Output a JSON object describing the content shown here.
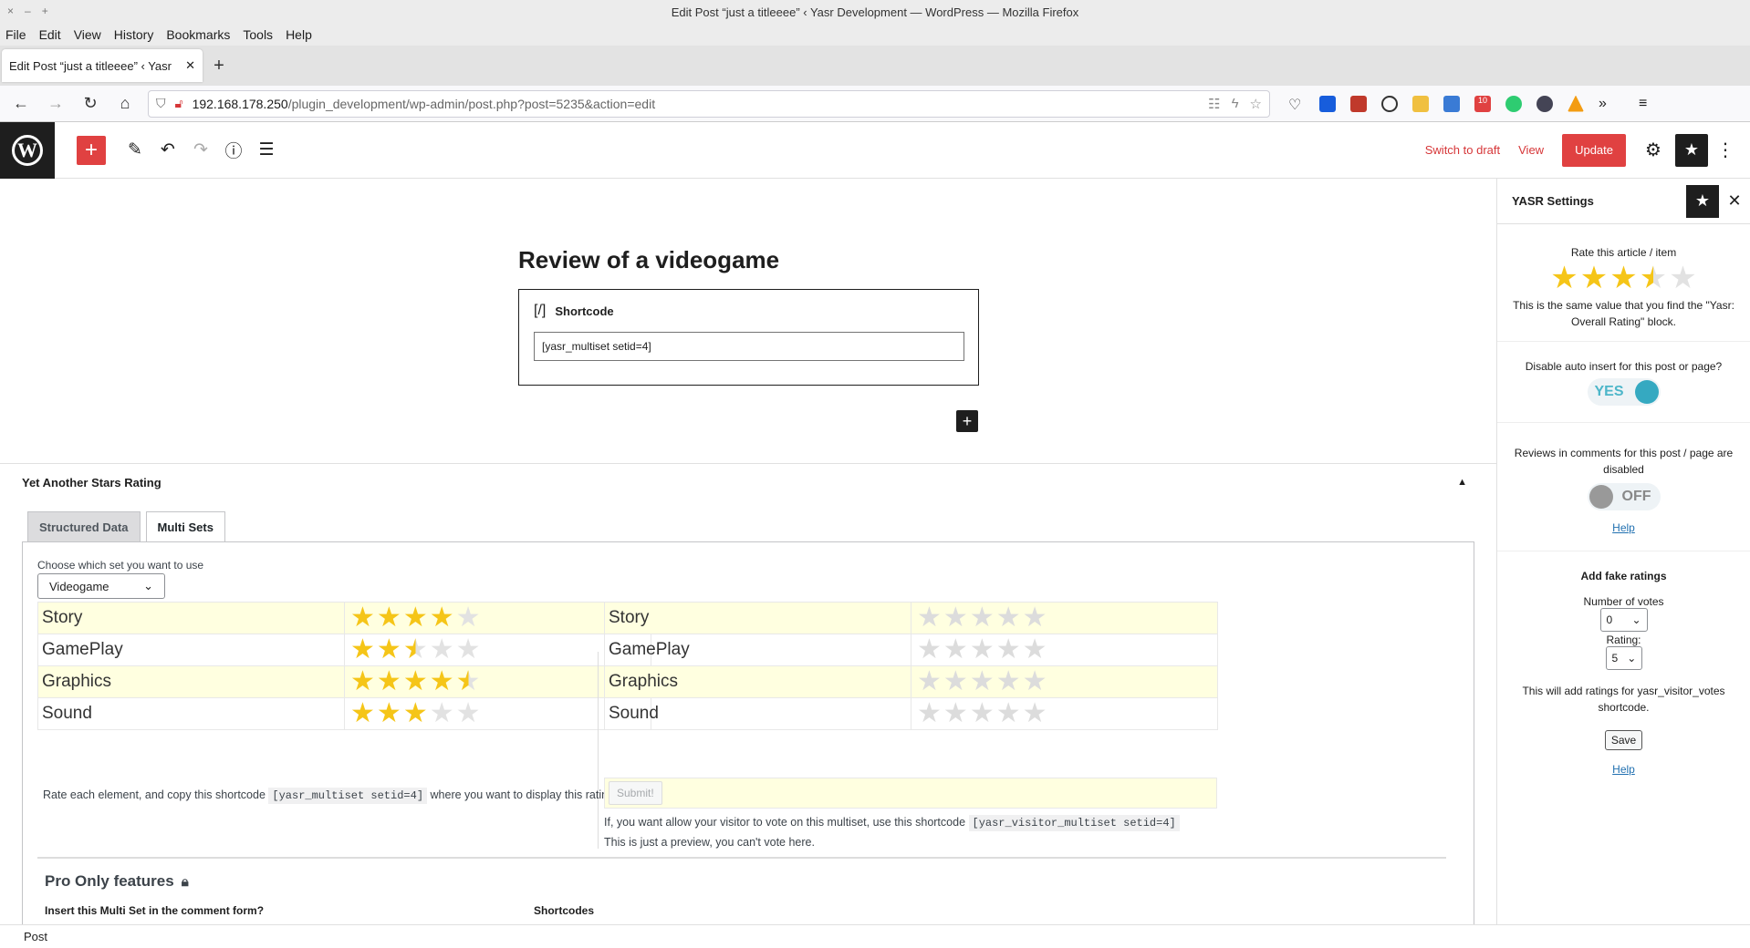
{
  "browser": {
    "window_title": "Edit Post “just a titleeee” ‹ Yasr Development — WordPress — Mozilla Firefox",
    "window_controls": [
      "×",
      "–",
      "+"
    ],
    "menu": [
      "File",
      "Edit",
      "View",
      "History",
      "Bookmarks",
      "Tools",
      "Help"
    ],
    "tab_title": "Edit Post “just a titleeee” ‹ Yasr",
    "url_host": "192.168.178.250",
    "url_path": "/plugin_development/wp-admin/post.php?post=5235&action=edit",
    "ext_badge": "10"
  },
  "toolbar": {
    "switch_to_draft": "Switch to draft",
    "view": "View",
    "update": "Update"
  },
  "editor": {
    "post_title": "Review of a videogame",
    "shortcode_icon": "[/]",
    "shortcode_label": "Shortcode",
    "shortcode_value": "[yasr_multiset setid=4]"
  },
  "metabox": {
    "title": "Yet Another Stars Rating",
    "tabs": [
      "Structured Data",
      "Multi Sets"
    ],
    "choose_label": "Choose which set you want to use",
    "selected_set": "Videogame",
    "left_rows": [
      {
        "name": "Story",
        "rating": 4
      },
      {
        "name": "GamePlay",
        "rating": 2.5
      },
      {
        "name": "Graphics",
        "rating": 4.5
      },
      {
        "name": "Sound",
        "rating": 3
      }
    ],
    "right_rows": [
      {
        "name": "Story",
        "rating": 0
      },
      {
        "name": "GamePlay",
        "rating": 0
      },
      {
        "name": "Graphics",
        "rating": 0
      },
      {
        "name": "Sound",
        "rating": 0
      }
    ],
    "left_note_pre": "Rate each element, and copy this shortcode",
    "left_note_code": "[yasr_multiset setid=4]",
    "left_note_post": "where you want to display this rating.",
    "submit_label": "Submit!",
    "right_note_pre": "If, you want allow your visitor to vote on this multiset, use this shortcode",
    "right_note_code": "[yasr_visitor_multiset setid=4]",
    "right_note_2": "This is just a preview, you can't vote here.",
    "pro_title": "Pro Only features",
    "pro_sub1": "Insert this Multi Set in the comment form?",
    "pro_sub2": "Shortcodes"
  },
  "sidebar": {
    "title": "YASR Settings",
    "rate_label": "Rate this article / item",
    "overall_rating": 3.5,
    "rate_note": "This is the same value that you find the \"Yasr: Overall Rating\" block.",
    "auto_insert_label": "Disable auto insert for this post or page?",
    "auto_insert_value": "YES",
    "reviews_label": "Reviews in comments for this post / page are disabled",
    "reviews_value": "OFF",
    "help1": "Help",
    "fake_title": "Add fake ratings",
    "votes_label": "Number of votes",
    "votes_value": "0",
    "rating_label": "Rating:",
    "rating_value": "5",
    "fake_note": "This will add ratings for yasr_visitor_votes shortcode.",
    "save": "Save",
    "help2": "Help"
  },
  "footer": {
    "breadcrumb": "Post"
  }
}
